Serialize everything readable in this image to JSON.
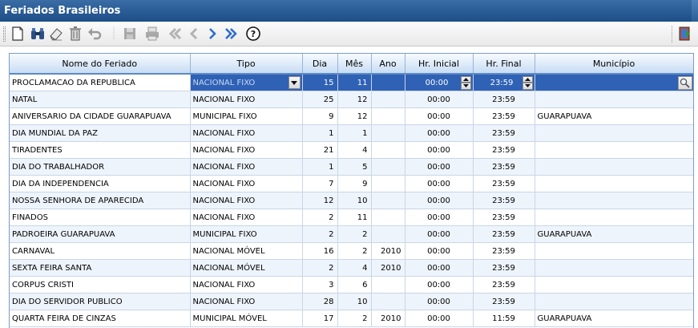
{
  "window": {
    "title": "Feriados Brasileiros"
  },
  "toolbar": {
    "buttons": [
      {
        "icon": "new-document-icon",
        "enabled": true
      },
      {
        "icon": "binoculars-icon",
        "enabled": true
      },
      {
        "icon": "eraser-icon",
        "enabled": true
      },
      {
        "icon": "trash-icon",
        "enabled": true
      },
      {
        "icon": "undo-icon",
        "enabled": false
      },
      {
        "icon": "save-icon",
        "enabled": false
      },
      {
        "icon": "print-icon",
        "enabled": false
      },
      {
        "icon": "first-record-icon",
        "enabled": false
      },
      {
        "icon": "previous-record-icon",
        "enabled": false
      },
      {
        "icon": "next-record-icon",
        "enabled": true
      },
      {
        "icon": "last-record-icon",
        "enabled": true
      },
      {
        "icon": "help-icon",
        "enabled": true
      },
      {
        "icon": "exit-door-icon",
        "enabled": true
      }
    ]
  },
  "grid": {
    "columns": [
      "Nome do Feriado",
      "Tipo",
      "Dia",
      "Mês",
      "Ano",
      "Hr. Inicial",
      "Hr. Final",
      "Município"
    ],
    "rows": [
      [
        "PROCLAMACAO DA REPUBLICA",
        "NACIONAL FIXO",
        "15",
        "11",
        "",
        "00:00",
        "23:59",
        ""
      ],
      [
        "NATAL",
        "NACIONAL FIXO",
        "25",
        "12",
        "",
        "00:00",
        "23:59",
        ""
      ],
      [
        "ANIVERSARIO DA CIDADE GUARAPUAVA",
        "MUNICIPAL FIXO",
        "9",
        "12",
        "",
        "00:00",
        "23:59",
        "GUARAPUAVA"
      ],
      [
        "DIA MUNDIAL DA PAZ",
        "NACIONAL FIXO",
        "1",
        "1",
        "",
        "00:00",
        "23:59",
        ""
      ],
      [
        "TIRADENTES",
        "NACIONAL FIXO",
        "21",
        "4",
        "",
        "00:00",
        "23:59",
        ""
      ],
      [
        "DIA DO TRABALHADOR",
        "NACIONAL FIXO",
        "1",
        "5",
        "",
        "00:00",
        "23:59",
        ""
      ],
      [
        "DIA DA INDEPENDENCIA",
        "NACIONAL FIXO",
        "7",
        "9",
        "",
        "00:00",
        "23:59",
        ""
      ],
      [
        "NOSSA SENHORA DE APARECIDA",
        "NACIONAL FIXO",
        "12",
        "10",
        "",
        "00:00",
        "23:59",
        ""
      ],
      [
        "FINADOS",
        "NACIONAL FIXO",
        "2",
        "11",
        "",
        "00:00",
        "23:59",
        ""
      ],
      [
        "PADROEIRA GUARAPUAVA",
        "MUNICIPAL FIXO",
        "2",
        "2",
        "",
        "00:00",
        "23:59",
        "GUARAPUAVA"
      ],
      [
        "CARNAVAL",
        "NACIONAL MÓVEL",
        "16",
        "2",
        "2010",
        "00:00",
        "23:59",
        ""
      ],
      [
        "SEXTA FEIRA SANTA",
        "NACIONAL MÓVEL",
        "2",
        "4",
        "2010",
        "00:00",
        "23:59",
        ""
      ],
      [
        "CORPUS CRISTI",
        "NACIONAL FIXO",
        "3",
        "6",
        "",
        "00:00",
        "23:59",
        ""
      ],
      [
        "DIA DO SERVIDOR PUBLICO",
        "NACIONAL FIXO",
        "28",
        "10",
        "",
        "00:00",
        "23:59",
        ""
      ],
      [
        "QUARTA FEIRA DE CINZAS",
        "MUNICIPAL MÓVEL",
        "17",
        "2",
        "2010",
        "00:00",
        "11:59",
        "GUARAPUAVA"
      ]
    ],
    "selected_row": 0
  },
  "colors": {
    "title_bar": "#2b5d96",
    "selection": "#2f61b5",
    "header_gradient_bottom": "#c7dcf4",
    "alt_row": "#eef4fc"
  }
}
